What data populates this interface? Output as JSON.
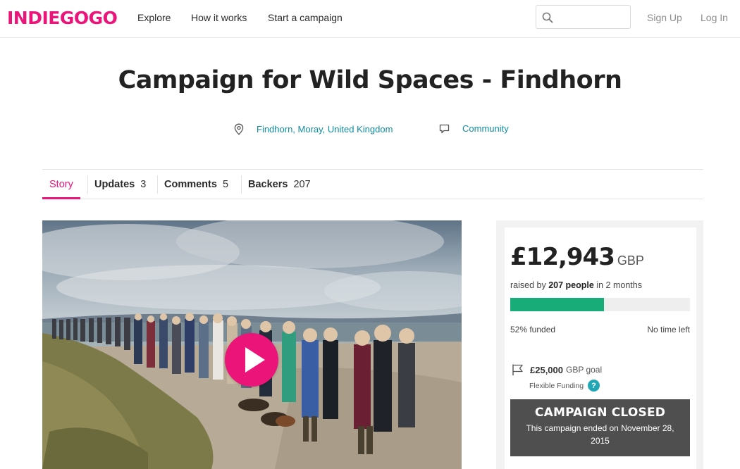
{
  "nav": {
    "logo": "INDIEGOGO",
    "explore": "Explore",
    "how_it_works": "How it works",
    "start_campaign": "Start a campaign",
    "search_placeholder": "",
    "sign_up": "Sign Up",
    "log_in": "Log In"
  },
  "campaign": {
    "title": "Campaign for Wild Spaces - Findhorn",
    "location": "Findhorn, Moray, United Kingdom",
    "category": "Community"
  },
  "tabs": [
    {
      "label": "Story",
      "count": ""
    },
    {
      "label": "Updates",
      "count": "3"
    },
    {
      "label": "Comments",
      "count": "5"
    },
    {
      "label": "Backers",
      "count": "207"
    }
  ],
  "funding": {
    "amount": "£12,943",
    "currency": "GBP",
    "raised_prefix": "raised by",
    "people": "207 people",
    "raised_suffix": "in 2 months",
    "percent_funded": 0.52,
    "percent_label": "52% funded",
    "time_left": "No time left",
    "goal_value": "£25,000",
    "goal_label": "GBP goal",
    "funding_type": "Flexible Funding",
    "help_symbol": "?",
    "closed_title": "CAMPAIGN CLOSED",
    "closed_text": "This campaign ended on November 28, 2015"
  },
  "colors": {
    "brand": "#eb1478",
    "link": "#0f8ea0",
    "progress": "#18ad78",
    "closed_bg": "#4f4f4f"
  },
  "icons": {
    "search": "search-icon",
    "location": "map-pin-icon",
    "category": "speech-bubble-icon",
    "goal": "flag-icon",
    "play": "play-icon"
  }
}
